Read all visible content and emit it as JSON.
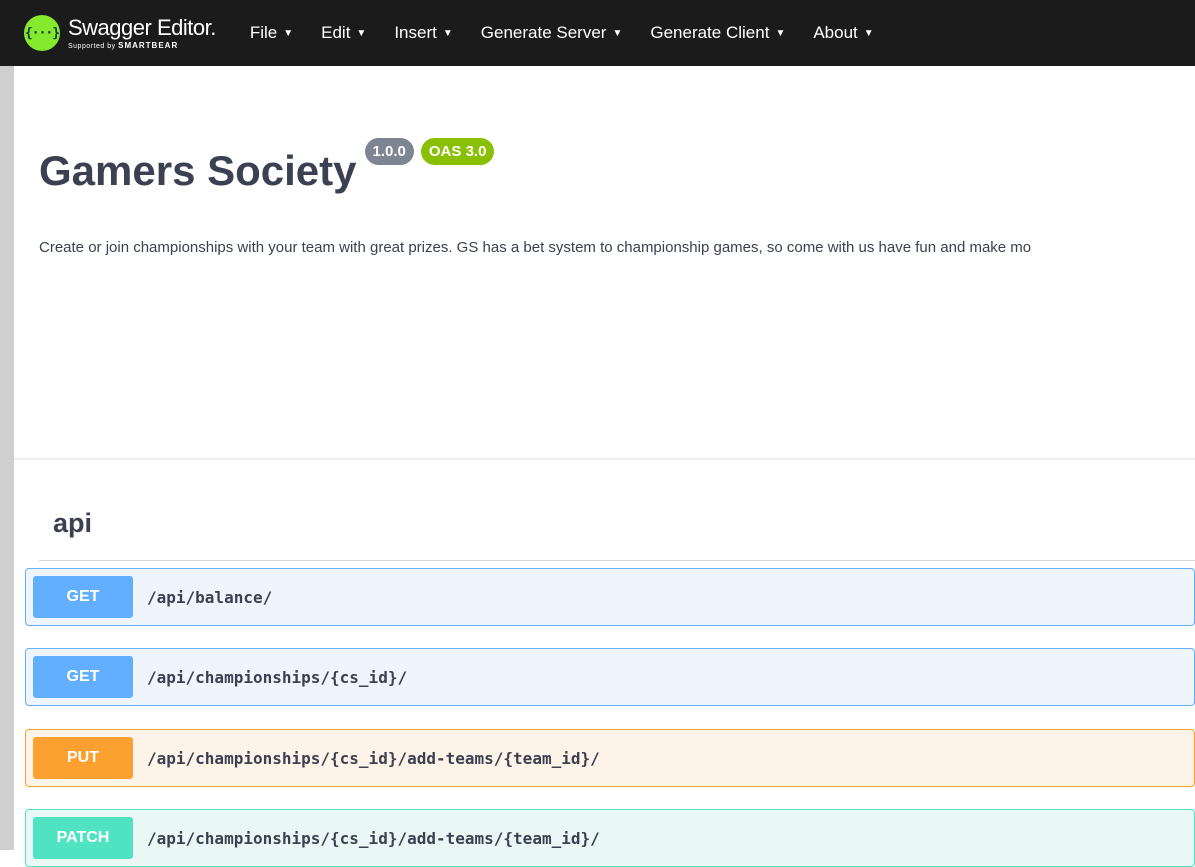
{
  "topbar": {
    "logo_title": "Swagger Editor.",
    "logo_sub_prefix": "Supported by",
    "logo_sub_brand": "SMARTBEAR",
    "menu": [
      {
        "label": "File"
      },
      {
        "label": "Edit"
      },
      {
        "label": "Insert"
      },
      {
        "label": "Generate Server"
      },
      {
        "label": "Generate Client"
      },
      {
        "label": "About"
      }
    ]
  },
  "info": {
    "title": "Gamers Society",
    "version": "1.0.0",
    "oas_version": "OAS 3.0",
    "description": "Create or join championships with your team with great prizes. GS has a bet system to championship games, so come with us have fun and make mo"
  },
  "tag": {
    "name": "api"
  },
  "operations": [
    {
      "method": "GET",
      "path": "/api/balance/"
    },
    {
      "method": "GET",
      "path": "/api/championships/{cs_id}/"
    },
    {
      "method": "PUT",
      "path": "/api/championships/{cs_id}/add-teams/{team_id}/"
    },
    {
      "method": "PATCH",
      "path": "/api/championships/{cs_id}/add-teams/{team_id}/"
    }
  ],
  "colors": {
    "get": "#61affe",
    "put": "#fca130",
    "patch": "#50e3c2",
    "topbar": "#1b1b1b",
    "logo": "#85ea2d",
    "version_badge": "#7d8492",
    "oas_badge": "#89bf04"
  },
  "icons": {
    "logo": "swagger-logo-icon",
    "caret": "caret-down-icon"
  }
}
